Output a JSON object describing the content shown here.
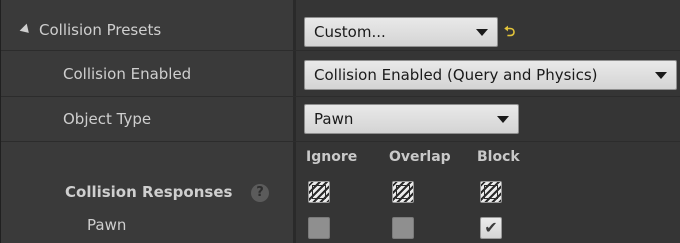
{
  "presets": {
    "label": "Collision Presets",
    "value": "Custom...",
    "reset_icon": "reset-arrow-icon",
    "expand_icon": "expanded-triangle-icon"
  },
  "enabled": {
    "label": "Collision Enabled",
    "value": "Collision Enabled (Query and Physics)"
  },
  "object_type": {
    "label": "Object Type",
    "value": "Pawn"
  },
  "columns": [
    "Ignore",
    "Overlap",
    "Block"
  ],
  "responses": {
    "label": "Collision Responses",
    "help_icon": "?",
    "header_state": [
      "mixed",
      "mixed",
      "mixed"
    ]
  },
  "channels": [
    {
      "label": "Pawn",
      "state": [
        "unchecked",
        "unchecked",
        "checked"
      ]
    }
  ],
  "colors": {
    "panel_bg": "#353535",
    "field_bg": "#dcdcdc",
    "reset_accent": "#e3c43a"
  }
}
